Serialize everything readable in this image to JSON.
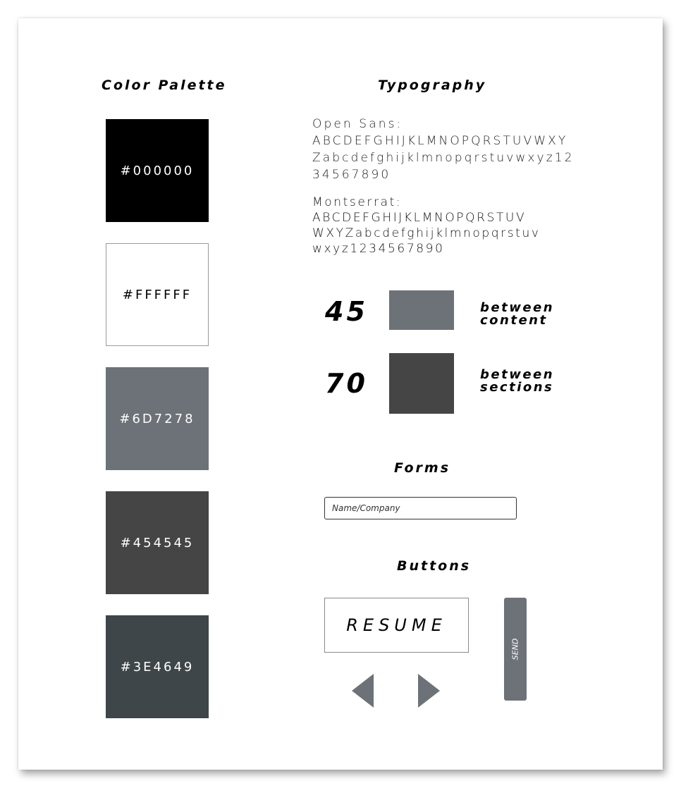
{
  "palette": {
    "title": "Color Palette",
    "swatches": [
      {
        "label": "#000000",
        "color": "#000000",
        "text_color": "#FFFFFF"
      },
      {
        "label": "#FFFFFF",
        "color": "#FFFFFF",
        "text_color": "#000000"
      },
      {
        "label": "#6D7278",
        "color": "#6D7278",
        "text_color": "#FFFFFF"
      },
      {
        "label": "#454545",
        "color": "#454545",
        "text_color": "#FFFFFF"
      },
      {
        "label": "#3E4649",
        "color": "#3E4649",
        "text_color": "#FFFFFF"
      }
    ]
  },
  "typography": {
    "title": "Typography",
    "open_sans": {
      "lines": [
        "Open Sans:",
        "ABCDEFGHIJKLMNOPQRSTUVWXY",
        "Zabcdefghijklmnopqrstuvwxyz12",
        "34567890"
      ]
    },
    "montserrat": {
      "lines": [
        "Montserrat:",
        "ABCDEFGHIJKLMNOPQRSTUV",
        "WXYZabcdefghijklmnopqrstuv",
        "wxyz1234567890"
      ]
    }
  },
  "spacing": {
    "items": [
      {
        "value": "45",
        "color": "#6D7278",
        "label_line1": "between",
        "label_line2": "content"
      },
      {
        "value": "70",
        "color": "#454545",
        "label_line1": "between",
        "label_line2": "sections"
      }
    ]
  },
  "forms": {
    "title": "Forms",
    "name_placeholder": "Name/Company"
  },
  "buttons": {
    "title": "Buttons",
    "resume_label": "RESUME",
    "send_label": "SEND",
    "arrow_color": "#6D7278",
    "prev_icon": "triangle-left-icon",
    "next_icon": "triangle-right-icon"
  }
}
